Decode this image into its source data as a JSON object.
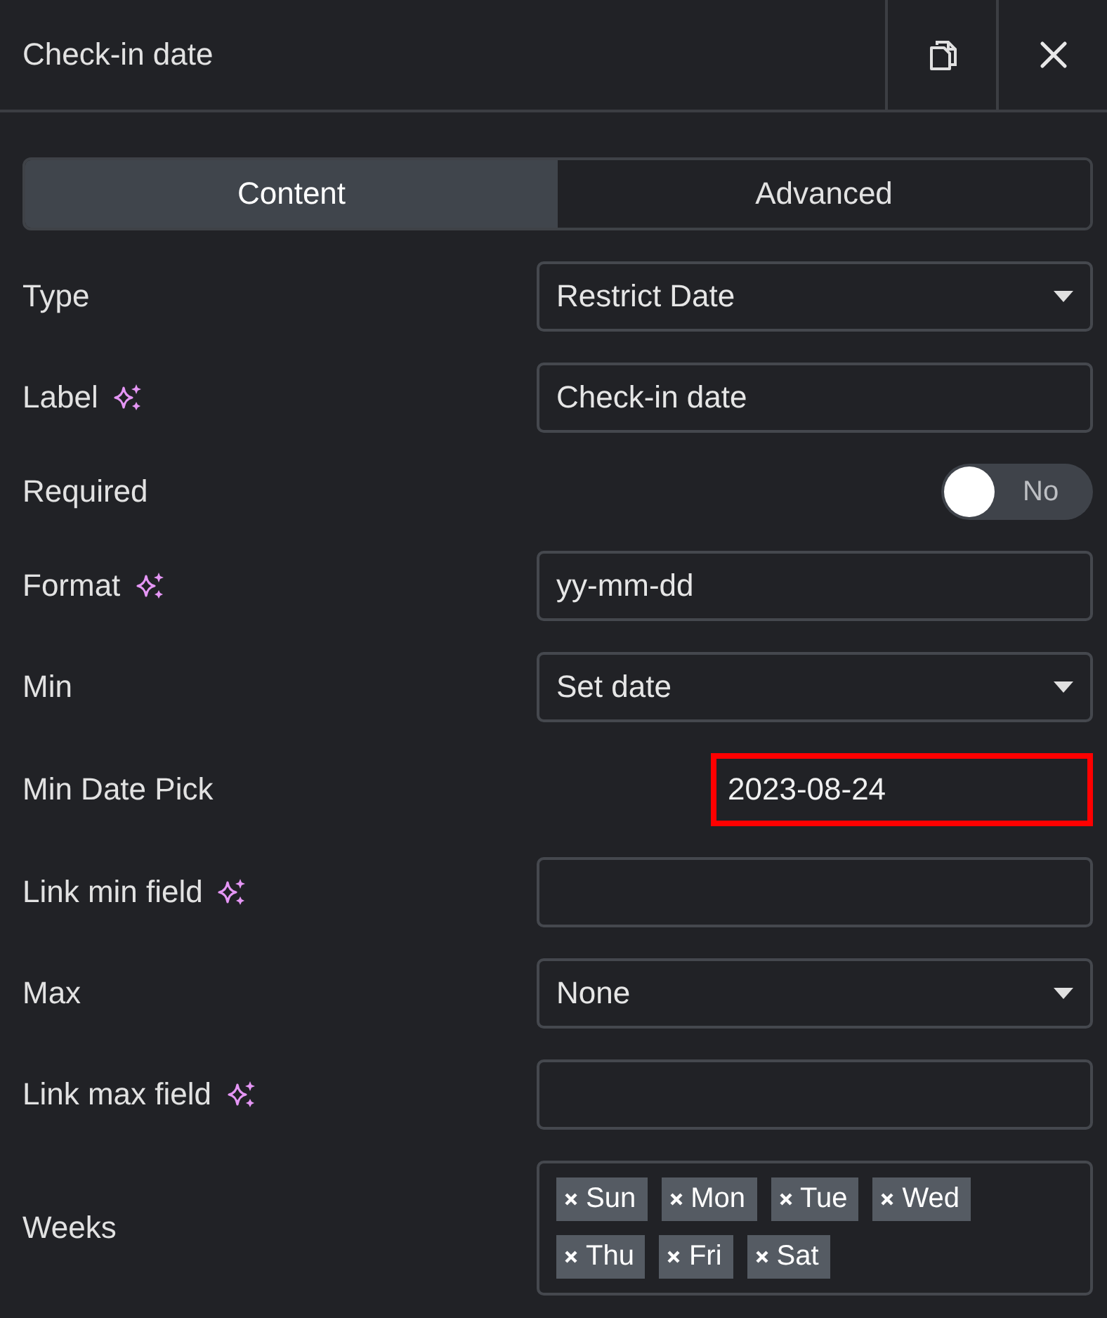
{
  "header": {
    "title": "Check-in date"
  },
  "tabs": [
    {
      "label": "Content",
      "selected": true
    },
    {
      "label": "Advanced",
      "selected": false
    }
  ],
  "fields": [
    {
      "kind": "select",
      "label": "Type",
      "ai": false,
      "value": "Restrict Date"
    },
    {
      "kind": "text",
      "label": "Label",
      "ai": true,
      "value": "Check-in date"
    },
    {
      "kind": "toggle",
      "label": "Required",
      "ai": false,
      "on": false,
      "value": "No"
    },
    {
      "kind": "text",
      "label": "Format",
      "ai": true,
      "value": "yy-mm-dd"
    },
    {
      "kind": "select",
      "label": "Min",
      "ai": false,
      "value": "Set date"
    },
    {
      "kind": "date",
      "label": "Min Date Pick",
      "ai": false,
      "value": "2023-08-24",
      "highlighted": true
    },
    {
      "kind": "text",
      "label": "Link min field",
      "ai": true
    },
    {
      "kind": "select",
      "label": "Max",
      "ai": false,
      "value": "None"
    },
    {
      "kind": "text",
      "label": "Link max field",
      "ai": true
    },
    {
      "kind": "tags",
      "label": "Weeks",
      "ai": false,
      "tags": [
        "Sun",
        "Mon",
        "Tue",
        "Wed",
        "Thu",
        "Fri",
        "Sat"
      ]
    }
  ]
}
